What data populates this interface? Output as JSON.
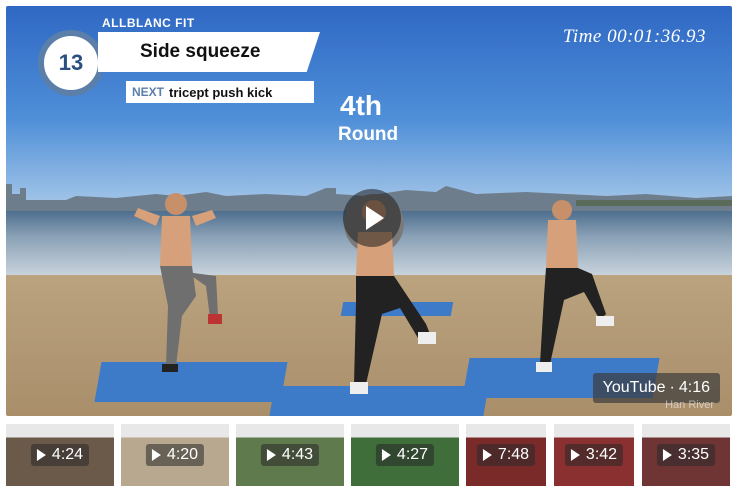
{
  "overlay": {
    "brand": "ALLBLANC FIT",
    "exercise_number": "13",
    "exercise_name": "Side squeeze",
    "next_label": "NEXT",
    "next_exercise": "tricept push kick",
    "round_number": "4th",
    "round_word": "Round",
    "timer_label": "Time",
    "timer_value": "00:01:36.93"
  },
  "player": {
    "source_label": "YouTube",
    "duration": "4:16",
    "watermark": "Han River"
  },
  "thumbnails": [
    {
      "duration": "4:24",
      "bg": "#6b5a4a"
    },
    {
      "duration": "4:20",
      "bg": "#b7a88f"
    },
    {
      "duration": "4:43",
      "bg": "#5f7a4c"
    },
    {
      "duration": "4:27",
      "bg": "#3f6e3a"
    },
    {
      "duration": "7:48",
      "bg": "#7b2a2a"
    },
    {
      "duration": "3:42",
      "bg": "#8a3030"
    },
    {
      "duration": "3:35",
      "bg": "#6f3535"
    }
  ],
  "colors": {
    "accent": "#5b7fa9",
    "mat": "#3d7ac8"
  }
}
